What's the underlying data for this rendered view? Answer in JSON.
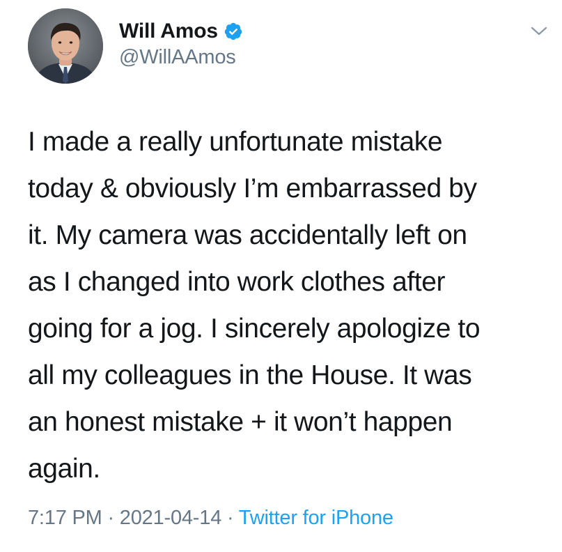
{
  "author": {
    "display_name": "Will Amos",
    "handle": "@WillAAmos",
    "verified": true,
    "avatar_icon": "profile-photo"
  },
  "tweet": {
    "text": "I made a really unfortunate mistake\ntoday & obviously I’m embarrassed by\nit. My camera was accidentally left on\nas I changed into work clothes after\ngoing for a jog. I sincerely apologize to\nall my colleagues in the House. It was\nan honest mistake + it won’t happen\nagain."
  },
  "meta": {
    "time": "7:17 PM",
    "separator": " · ",
    "date": "2021-04-14",
    "source": "Twitter for iPhone"
  },
  "menu": {
    "icon": "chevron-down-icon"
  },
  "colors": {
    "text": "#14171a",
    "secondary": "#657786",
    "accent": "#1da1f2"
  }
}
